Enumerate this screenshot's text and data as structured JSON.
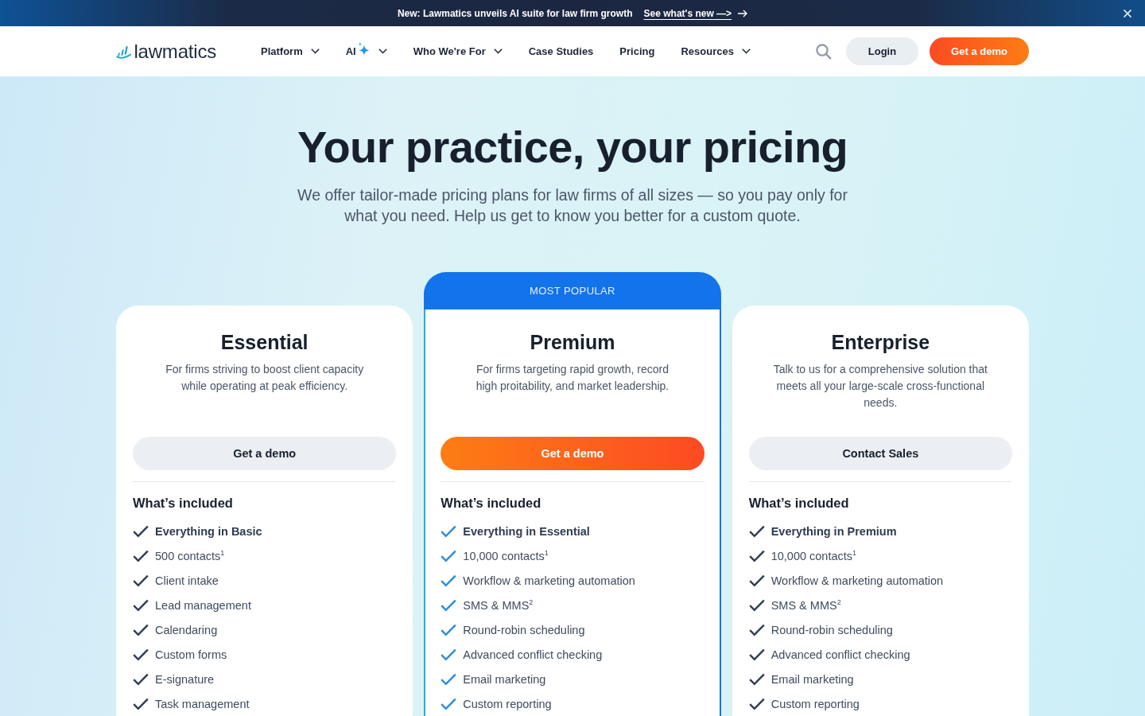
{
  "announcement": {
    "text": "New: Lawmatics unveils AI suite for law firm growth",
    "link": "See what's new —>"
  },
  "nav": {
    "logo": "lawmatics",
    "items": [
      {
        "label": "Platform",
        "kind": "dropdown"
      },
      {
        "label": "AI",
        "kind": "ai-dropdown"
      },
      {
        "label": "Who We're For",
        "kind": "dropdown"
      },
      {
        "label": "Case Studies",
        "kind": "link"
      },
      {
        "label": "Pricing",
        "kind": "link"
      },
      {
        "label": "Resources",
        "kind": "dropdown"
      }
    ],
    "login": "Login",
    "cta": "Get a demo"
  },
  "hero": {
    "title": "Your practice, your pricing",
    "subtitle": "We offer tailor-made pricing plans for law firms of all sizes — so you pay only for what you need. Help us get to know you better for a custom quote."
  },
  "plans": [
    {
      "name": "Essential",
      "description": "For firms striving to boost client capacity while operating at peak efficiency.",
      "button": "Get a demo",
      "highlighted": false,
      "features_heading": "What’s included",
      "features": [
        {
          "text": "Everything in Basic",
          "kind": "summary"
        },
        {
          "text": "500 contacts$^{1}$",
          "kind": "feature"
        },
        {
          "text": "Client intake",
          "kind": "feature"
        },
        {
          "text": "Lead management",
          "kind": "feature"
        },
        {
          "text": "Calendaring",
          "kind": "feature"
        },
        {
          "text": "Custom forms",
          "kind": "feature"
        },
        {
          "text": "E-signature",
          "kind": "feature"
        },
        {
          "text": "Task management",
          "kind": "feature"
        }
      ]
    },
    {
      "name": "Premium",
      "badge": "MOST POPULAR",
      "description": "For firms targeting rapid growth, record high proitability, and market leadership.",
      "button": "Get a demo",
      "highlighted": true,
      "features_heading": "What’s included",
      "features": [
        {
          "text": "Everything in Essential",
          "kind": "summary"
        },
        {
          "text": "10,000 contacts$^{1}$",
          "kind": "feature"
        },
        {
          "text": "Workflow & marketing automation",
          "kind": "feature"
        },
        {
          "text": "SMS & MMS$^{2}$",
          "kind": "feature"
        },
        {
          "text": "Round-robin scheduling",
          "kind": "feature"
        },
        {
          "text": "Advanced conflict checking",
          "kind": "feature"
        },
        {
          "text": "Email marketing",
          "kind": "feature"
        },
        {
          "text": "Custom reporting",
          "kind": "feature"
        }
      ]
    },
    {
      "name": "Enterprise",
      "description": "Talk to us for a comprehensive solution that meets all your large-scale cross-functional needs.",
      "button": "Contact Sales",
      "highlighted": false,
      "features_heading": "What’s included",
      "features": [
        {
          "text": "Everything in Premium",
          "kind": "summary"
        },
        {
          "text": "10,000 contacts$^{1}$",
          "kind": "feature"
        },
        {
          "text": "Workflow & marketing automation",
          "kind": "feature"
        },
        {
          "text": "SMS & MMS$^{2}$",
          "kind": "feature"
        },
        {
          "text": "Round-robin scheduling",
          "kind": "feature"
        },
        {
          "text": "Advanced conflict checking",
          "kind": "feature"
        },
        {
          "text": "Email marketing",
          "kind": "feature"
        },
        {
          "text": "Custom reporting",
          "kind": "feature"
        }
      ]
    }
  ]
}
